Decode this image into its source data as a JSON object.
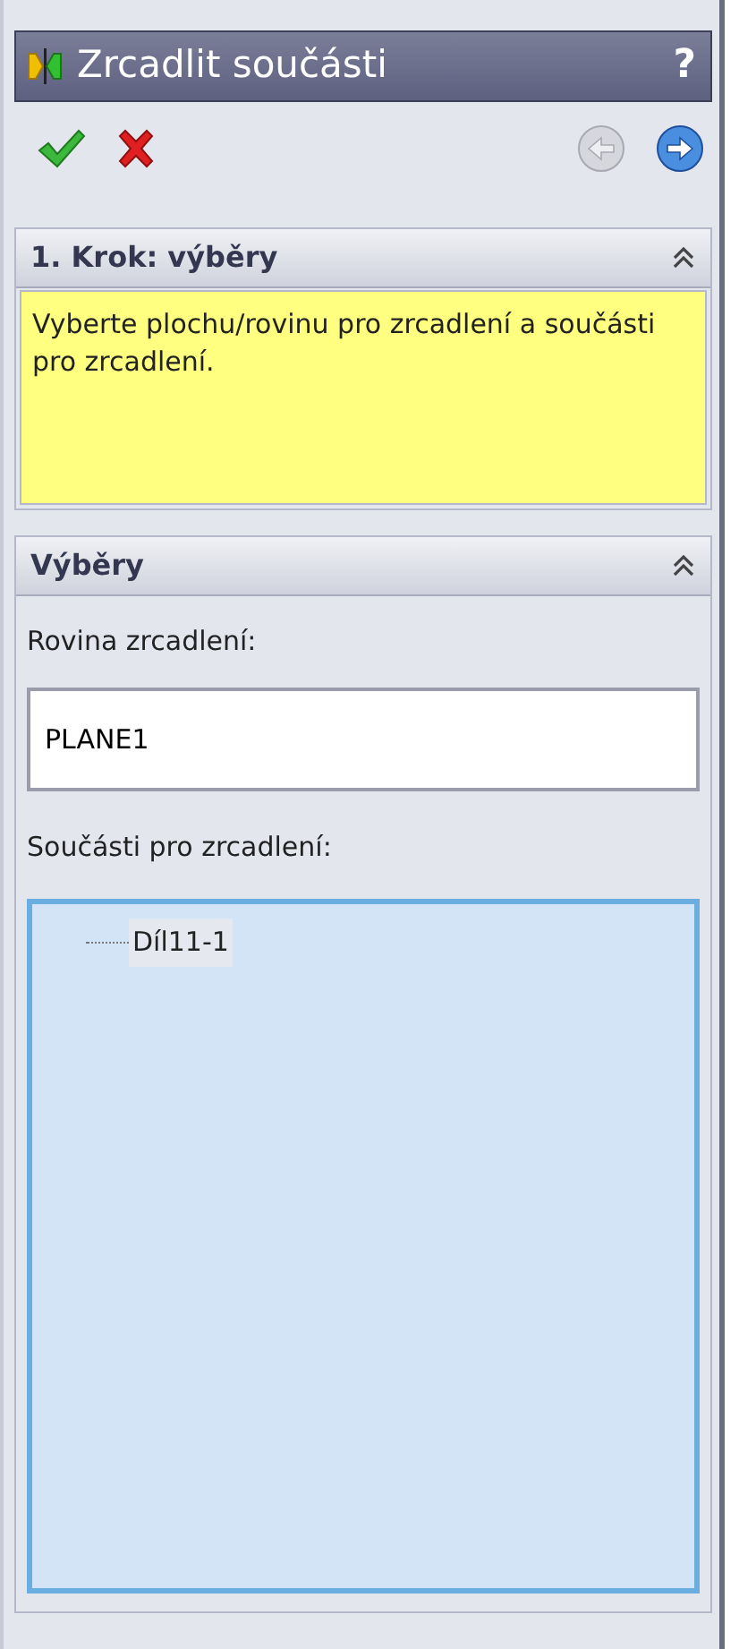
{
  "window": {
    "title": "Zrcadlit součásti",
    "help": "?"
  },
  "toolbar": {
    "buttons": [
      {
        "kind": "ok",
        "disabled": false
      },
      {
        "kind": "cancel",
        "disabled": false
      },
      {
        "kind": "back",
        "disabled": true
      },
      {
        "kind": "next",
        "disabled": false
      }
    ]
  },
  "groups": [
    {
      "title": "1. Krok: výběry",
      "expanded": true,
      "kind": "message",
      "text": "Vyberte plochu/rovinu pro zrcadlení a součásti pro zrcadlení."
    },
    {
      "title": "Výběry",
      "expanded": true,
      "kind": "selections",
      "fields": [
        {
          "label": "Rovina zrcadlení:",
          "value": "PLANE1"
        }
      ],
      "list_label": "Součásti pro zrcadlení:",
      "items": [
        {
          "label": "Díl11-1",
          "selected": true
        }
      ]
    }
  ]
}
